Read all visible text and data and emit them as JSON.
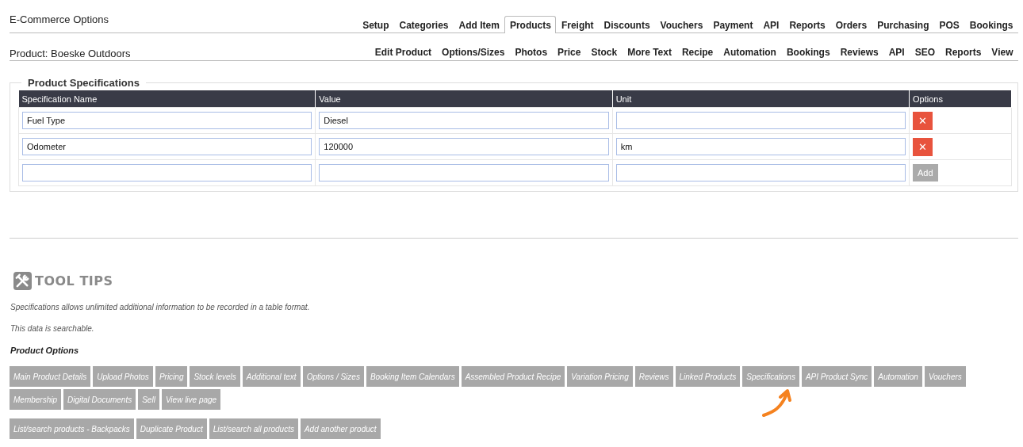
{
  "header": {
    "title": "E-Commerce Options",
    "tabs": [
      {
        "label": "Setup",
        "selected": false
      },
      {
        "label": "Categories",
        "selected": false
      },
      {
        "label": "Add Item",
        "selected": false
      },
      {
        "label": "Products",
        "selected": true
      },
      {
        "label": "Freight",
        "selected": false
      },
      {
        "label": "Discounts",
        "selected": false
      },
      {
        "label": "Vouchers",
        "selected": false
      },
      {
        "label": "Payment",
        "selected": false
      },
      {
        "label": "API",
        "selected": false
      },
      {
        "label": "Reports",
        "selected": false
      },
      {
        "label": "Orders",
        "selected": false
      },
      {
        "label": "Purchasing",
        "selected": false
      },
      {
        "label": "POS",
        "selected": false
      },
      {
        "label": "Bookings",
        "selected": false
      }
    ]
  },
  "subheader": {
    "title": "Product: Boeske Outdoors",
    "links": [
      "Edit Product",
      "Options/Sizes",
      "Photos",
      "Price",
      "Stock",
      "More Text",
      "Recipe",
      "Automation",
      "Bookings",
      "Reviews",
      "API",
      "SEO",
      "Reports",
      "View"
    ]
  },
  "specifications": {
    "legend": "Product Specifications",
    "columns": [
      "Specification Name",
      "Value",
      "Unit",
      "Options"
    ],
    "rows": [
      {
        "name": "Fuel Type",
        "value": "Diesel",
        "unit": "",
        "action": {
          "kind": "delete",
          "label": "✕"
        }
      },
      {
        "name": "Odometer",
        "value": "120000",
        "unit": "km",
        "action": {
          "kind": "delete",
          "label": "✕"
        }
      },
      {
        "name": "",
        "value": "",
        "unit": "",
        "action": {
          "kind": "add",
          "label": "Add"
        }
      }
    ]
  },
  "tool_tips": {
    "title": "TOOL TIPS",
    "paragraphs": [
      "Specifications allows unlimited additional information to be recorded in a table format.",
      "This data is searchable."
    ],
    "options_heading": "Product Options",
    "option_rows": [
      [
        "Main Product Details",
        "Upload Photos",
        "Pricing",
        "Stock levels",
        "Additional text",
        "Options / Sizes",
        "Booking Item Calendars",
        "Assembled Product Recipe",
        "Variation Pricing",
        "Reviews",
        "Linked Products",
        "Specifications",
        "API Product Sync",
        "Automation",
        "Vouchers"
      ],
      [
        "Membership",
        "Digital Documents",
        "Sell",
        "View live page"
      ]
    ],
    "action_buttons": [
      "List/search products - Backpacks",
      "Duplicate Product",
      "List/search all products",
      "Add another product"
    ]
  }
}
